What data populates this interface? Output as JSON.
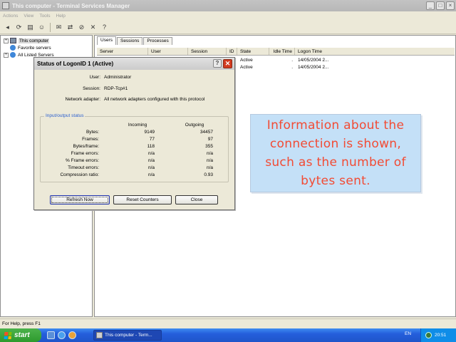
{
  "window": {
    "title": "This computer - Terminal Services Manager",
    "controls": [
      "_",
      "□",
      "×"
    ]
  },
  "menu": [
    "Actions",
    "View",
    "Tools",
    "Help"
  ],
  "toolbar": {
    "icons": [
      "back-icon",
      "refresh-icon",
      "server-icon",
      "users-icon",
      "send-message-icon",
      "connect-icon",
      "disconnect-icon",
      "close-icon",
      "help-icon"
    ]
  },
  "tree": {
    "items": [
      {
        "label": "This computer",
        "selected": true,
        "expander": "+"
      },
      {
        "label": "Favorite servers",
        "selected": false,
        "expander": ""
      },
      {
        "label": "All Listed Servers",
        "selected": false,
        "expander": "+"
      }
    ]
  },
  "tabs": [
    "Users",
    "Sessions",
    "Processes"
  ],
  "list": {
    "columns": [
      "Server",
      "User",
      "Session",
      "ID",
      "State",
      "Idle Time",
      "Logon Time"
    ],
    "rows": [
      [
        "",
        "",
        "",
        "",
        "Active",
        ".",
        "14/05/2004 2..."
      ],
      [
        "",
        "",
        "",
        "",
        "Active",
        ".",
        "14/05/2004 2..."
      ]
    ]
  },
  "statusbar": {
    "text": "For Help, press F1"
  },
  "taskbar": {
    "start": "start",
    "task": "This computer - Term...",
    "lang": "EN",
    "clock": "20:51"
  },
  "dialog": {
    "title": "Status of LogonID 1  (Active)",
    "user_label": "User:",
    "user_value": "Administrator",
    "session_label": "Session:",
    "session_value": "RDP-Tcp#1",
    "adapter_label": "Network adapter:",
    "adapter_value": "All network adapters configured with this protocol",
    "group_title": "Input/output status",
    "col_incoming": "Incoming",
    "col_outgoing": "Outgoing",
    "stats": [
      {
        "label": "Bytes:",
        "in": "9149",
        "out": "34457"
      },
      {
        "label": "Frames:",
        "in": "77",
        "out": "97"
      },
      {
        "label": "Bytes/frame:",
        "in": "118",
        "out": "355"
      },
      {
        "label": "Frame errors:",
        "in": "n/a",
        "out": "n/a"
      },
      {
        "label": "% Frame errors:",
        "in": "n/a",
        "out": "n/a"
      },
      {
        "label": "Timeout errors:",
        "in": "n/a",
        "out": "n/a"
      },
      {
        "label": "Compression ratio:",
        "in": "n/a",
        "out": "0.93"
      }
    ],
    "btn_refresh": "Refresh Now",
    "btn_reset": "Reset Counters",
    "btn_close": "Close"
  },
  "callout": {
    "text": "Information about the connection is shown, such as the number of bytes sent."
  },
  "colors": {
    "callout_bg": "#c4e0f7",
    "callout_text": "#f24b34",
    "close_button": "#d23a1f",
    "taskbar": "#245edc",
    "start_button": "#2e9a2e"
  }
}
